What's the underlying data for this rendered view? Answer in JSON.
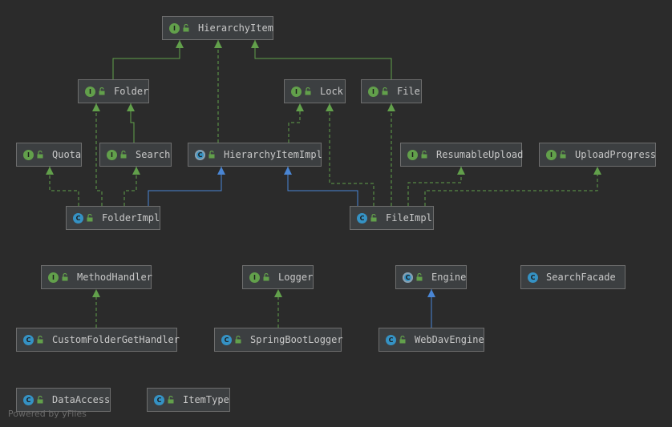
{
  "colors": {
    "background": "#2b2b2b",
    "node_fill": "#3c3f41",
    "node_border": "#6e6e6e",
    "interface_badge": "#62a04b",
    "class_badge": "#3592c4",
    "implements_edge": "#62a04b",
    "extends_edge": "#4a86d4",
    "text": "#c8c8c8"
  },
  "nodes": {
    "hierarchy_item": {
      "name": "HierarchyItem",
      "kind": "I"
    },
    "folder": {
      "name": "Folder",
      "kind": "I"
    },
    "lock": {
      "name": "Lock",
      "kind": "I"
    },
    "file": {
      "name": "File",
      "kind": "I"
    },
    "quota": {
      "name": "Quota",
      "kind": "I"
    },
    "search": {
      "name": "Search",
      "kind": "I"
    },
    "hierarchy_item_impl": {
      "name": "HierarchyItemImpl",
      "kind": "C"
    },
    "resumable_upload": {
      "name": "ResumableUpload",
      "kind": "I"
    },
    "upload_progress": {
      "name": "UploadProgress",
      "kind": "I"
    },
    "folder_impl": {
      "name": "FolderImpl",
      "kind": "C"
    },
    "file_impl": {
      "name": "FileImpl",
      "kind": "C"
    },
    "method_handler": {
      "name": "MethodHandler",
      "kind": "I"
    },
    "logger": {
      "name": "Logger",
      "kind": "I"
    },
    "engine": {
      "name": "Engine",
      "kind": "C"
    },
    "search_facade": {
      "name": "SearchFacade",
      "kind": "C"
    },
    "custom_folder_get_handler": {
      "name": "CustomFolderGetHandler",
      "kind": "C"
    },
    "spring_boot_logger": {
      "name": "SpringBootLogger",
      "kind": "C"
    },
    "web_dav_engine": {
      "name": "WebDavEngine",
      "kind": "C"
    },
    "data_access": {
      "name": "DataAccess",
      "kind": "C"
    },
    "item_type": {
      "name": "ItemType",
      "kind": "C"
    }
  },
  "edges": [
    {
      "from": "folder",
      "to": "hierarchy_item",
      "type": "extends-interface"
    },
    {
      "from": "hierarchy_item_impl",
      "to": "hierarchy_item",
      "type": "implements"
    },
    {
      "from": "file",
      "to": "hierarchy_item",
      "type": "extends-interface"
    },
    {
      "from": "search",
      "to": "folder",
      "type": "extends-interface"
    },
    {
      "from": "hierarchy_item_impl",
      "to": "lock",
      "type": "implements"
    },
    {
      "from": "folder_impl",
      "to": "quota",
      "type": "implements"
    },
    {
      "from": "folder_impl",
      "to": "folder",
      "type": "implements"
    },
    {
      "from": "folder_impl",
      "to": "search",
      "type": "implements"
    },
    {
      "from": "folder_impl",
      "to": "hierarchy_item_impl",
      "type": "extends"
    },
    {
      "from": "file_impl",
      "to": "hierarchy_item_impl",
      "type": "extends"
    },
    {
      "from": "file_impl",
      "to": "lock",
      "type": "implements"
    },
    {
      "from": "file_impl",
      "to": "file",
      "type": "implements"
    },
    {
      "from": "file_impl",
      "to": "resumable_upload",
      "type": "implements"
    },
    {
      "from": "file_impl",
      "to": "upload_progress",
      "type": "implements"
    },
    {
      "from": "custom_folder_get_handler",
      "to": "method_handler",
      "type": "implements"
    },
    {
      "from": "spring_boot_logger",
      "to": "logger",
      "type": "implements"
    },
    {
      "from": "web_dav_engine",
      "to": "engine",
      "type": "extends"
    }
  ],
  "footer": "Powered by yFiles"
}
